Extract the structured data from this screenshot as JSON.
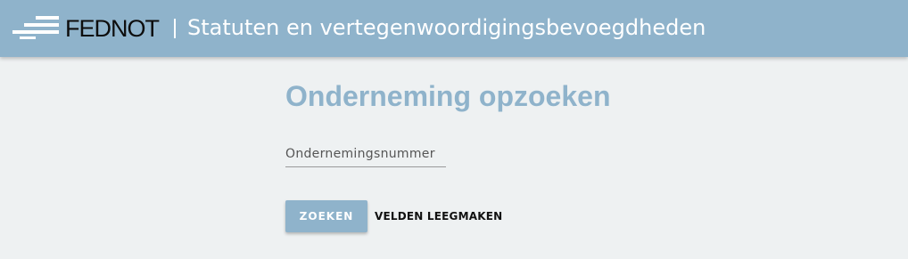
{
  "header": {
    "brand": "FEDNOT",
    "logo_icon": "stacked-lines-logo-icon",
    "title": "Statuten en vertegenwoordigingsbevoegdheden"
  },
  "main": {
    "title": "Onderneming opzoeken",
    "company_number": {
      "placeholder": "Ondernemingsnummer",
      "value": ""
    },
    "search_button": "ZOEKEN",
    "clear_button": "VELDEN LEEGMAKEN"
  },
  "colors": {
    "accent": "#8fb3cb",
    "background": "#eef1f2",
    "header_text": "#ffffff"
  }
}
